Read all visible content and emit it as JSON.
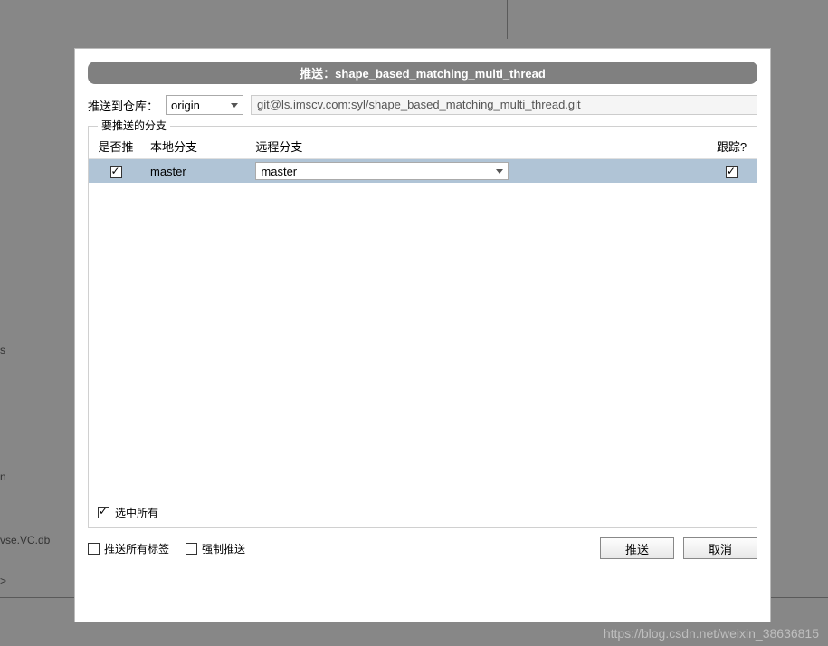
{
  "dialog": {
    "title": "推送：shape_based_matching_multi_thread",
    "repoLabel": "推送到仓库：",
    "remoteDropdown": "origin",
    "repoUrl": "git@ls.imscv.com:syl/shape_based_matching_multi_thread.git"
  },
  "fieldset": {
    "legend": "要推送的分支",
    "headers": {
      "push": "是否推",
      "local": "本地分支",
      "remote": "远程分支",
      "track": "跟踪?"
    },
    "rows": [
      {
        "push": true,
        "local": "master",
        "remote": "master",
        "track": true
      }
    ],
    "selectAll": {
      "checked": true,
      "label": "选中所有"
    }
  },
  "options": {
    "pushTags": {
      "checked": false,
      "label": "推送所有标签"
    },
    "force": {
      "checked": false,
      "label": "强制推送"
    }
  },
  "buttons": {
    "push": "推送",
    "cancel": "取消"
  },
  "watermark": "https://blog.csdn.net/weixin_38636815",
  "bg": {
    "s": "s",
    "n": "n",
    "db": "vse.VC.db",
    "arrow": ">"
  }
}
